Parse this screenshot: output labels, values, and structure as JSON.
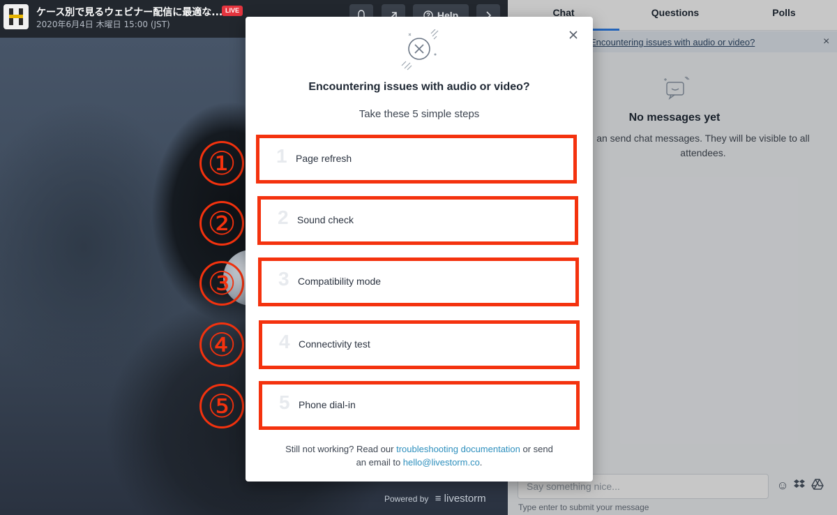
{
  "header": {
    "title": "ケース別で見るウェビナー配信に最適な...",
    "live_badge": "LIVE",
    "subtitle": "2020年6月4日 木曜日 15:00 (JST)",
    "help_label": "Help",
    "icons": {
      "bell": "bell-icon",
      "share": "share-icon",
      "help": "help-circle-icon",
      "next": "chevron-right-icon"
    }
  },
  "annotations": [
    "①",
    "②",
    "③",
    "④",
    "⑤"
  ],
  "powered_by": {
    "prefix": "Powered by",
    "brand": "livestorm"
  },
  "sidebar": {
    "tabs": [
      {
        "label": "Chat",
        "active": true
      },
      {
        "label": "Questions",
        "active": false
      },
      {
        "label": "Polls",
        "active": false
      }
    ],
    "notice": "Encountering issues with audio or video?",
    "empty_title": "No messages yet",
    "empty_desc": "an send chat messages. They will be visible to all attendees.",
    "input_placeholder": "Say something nice...",
    "input_hint": "Type enter to submit your message"
  },
  "modal": {
    "title": "Encountering issues with audio or video?",
    "subtitle": "Take these 5 simple steps",
    "steps": [
      {
        "num": "1",
        "label": "Page refresh"
      },
      {
        "num": "2",
        "label": "Sound check"
      },
      {
        "num": "3",
        "label": "Compatibility mode"
      },
      {
        "num": "4",
        "label": "Connectivity test"
      },
      {
        "num": "5",
        "label": "Phone dial-in"
      }
    ],
    "footer": {
      "t1": "Still not working? Read our ",
      "link1": "troubleshooting documentation",
      "t2": " or send",
      "t3": "an email to ",
      "link2": "hello@livestorm.co",
      "t4": "."
    }
  },
  "colors": {
    "highlight": "#f4320e",
    "link": "#2d8fbd",
    "accent_tab": "#2f80ed",
    "live": "#e5353f"
  }
}
